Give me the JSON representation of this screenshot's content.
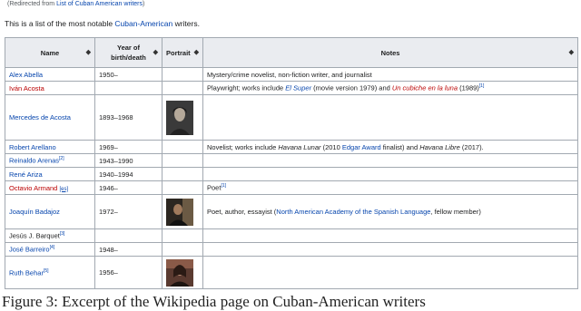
{
  "redirect": {
    "prefix": "(Redirected from ",
    "link": "List of Cuban American writers",
    "suffix": ")"
  },
  "intro": {
    "prefix": "This is a list of the most notable ",
    "link": "Cuban-American",
    "suffix": " writers."
  },
  "headers": {
    "name": "Name",
    "year": "Year of birth/death",
    "portrait": "Portrait",
    "notes": "Notes",
    "sort_glyph": "◆"
  },
  "rows": {
    "r0": {
      "name": "Alex Abella",
      "year": "1950–",
      "notes": "Mystery/crime novelist, non-fiction writer, and journalist"
    },
    "r1": {
      "name": "Iván Acosta",
      "year": "",
      "notes_a": "Playwright; works include ",
      "notes_b": "El Super",
      "notes_c": " (movie version 1979) and ",
      "notes_d": "Un cubiche en la luna",
      "notes_e": " (1989)",
      "ref": "[1]"
    },
    "r2": {
      "name": "Mercedes de Acosta",
      "year": "1893–1968",
      "notes": ""
    },
    "r3": {
      "name": "Robert Arellano",
      "year": "1969–",
      "notes_a": "Novelist; works include ",
      "notes_b": "Havana Lunar",
      "notes_c": " (2010 ",
      "notes_d": "Edgar Award",
      "notes_e": " finalist) and ",
      "notes_f": "Havana Libre",
      "notes_g": " (2017)."
    },
    "r4": {
      "name": "Reinaldo Arenas",
      "ref": "[2]",
      "year": "1943–1990",
      "notes": ""
    },
    "r5": {
      "name": "René Ariza",
      "year": "1940–1994",
      "notes": ""
    },
    "r6": {
      "name": "Octavio Armand",
      "ill": "[es]",
      "year": "1946–",
      "notes": "Poet",
      "ref": "[1]"
    },
    "r7": {
      "name": "Joaquín Badajoz",
      "year": "1972–",
      "notes_a": "Poet, author, essayist (",
      "notes_b": "North American Academy of the Spanish Language",
      "notes_c": ", fellow member)"
    },
    "r8": {
      "name": "Jesús J. Barquet",
      "ref": "[3]",
      "year": "",
      "notes": ""
    },
    "r9": {
      "name": "José Barreiro",
      "ref": "[4]",
      "year": "1948–",
      "notes": ""
    },
    "r10": {
      "name": "Ruth Behar",
      "ref": "[5]",
      "year": "1956–",
      "notes": ""
    }
  },
  "footer": "Figure 3: Excerpt of the Wikipedia page on Cuban-American writers"
}
